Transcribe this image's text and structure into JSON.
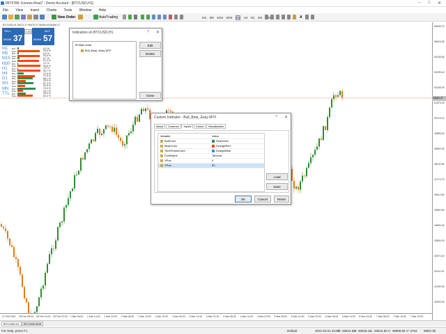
{
  "window": {
    "title": "8979786: Exness-Real7 - Demo Account - [BTCUSD,H1]"
  },
  "menu": [
    "File",
    "View",
    "Insert",
    "Charts",
    "Tools",
    "Window",
    "Help"
  ],
  "toolbar": {
    "new_order": "New Order",
    "auto_trading": "AutoTrading",
    "timeframes": [
      "M1",
      "M5",
      "M15",
      "M30",
      "H1",
      "H4",
      "D1",
      "W1",
      "MN"
    ]
  },
  "chart": {
    "symbol_label": "BTCUSD,H1  56471.47 56470.47 56450.45 56466.47",
    "current_price": "53653.47",
    "price_scale": [
      "55935.70",
      "55015.60",
      "54155.50",
      "53295.40",
      "52435.30",
      "51575.20",
      "50715.10",
      "49855.00",
      "48994.90",
      "48134.80",
      "47274.70",
      "46414.60",
      "45554.50",
      "44694.40",
      "43834.30",
      "42974.20",
      "42114.10",
      "41254.00",
      "40393.90"
    ],
    "time_scale": [
      "27 Feb 2021",
      "28 Feb 06:00",
      "28 Feb 14:00",
      "28 Feb 22:00",
      "1 Mar 06:00",
      "1 Mar 14:00",
      "1 Mar 22:00",
      "2 Mar 06:00",
      "2 Mar 14:00",
      "2 Mar 22:00",
      "3 Mar 06:00",
      "3 Mar 14:00",
      "3 Mar 22:00",
      "4 Mar 06:00",
      "4 Mar 14:00",
      "4 Mar 22:00",
      "5 Mar 06:00",
      "5 Mar 14:00",
      "5 Mar 22:00",
      "6 Mar 06:00",
      "6 Mar 14:00",
      "6 Mar 22:00",
      "7 Mar 06:00",
      "7 Mar 14:00",
      "7 Mar 22:00"
    ]
  },
  "oneclick": {
    "sell": "SELL",
    "buy": "BUY",
    "lot": "1.00",
    "sell_big": "37",
    "sell_small": "58458",
    "buy_big": "57",
    "buy_small": "58468"
  },
  "mtf": [
    {
      "tf": "M1",
      "bull": "Bull",
      "bear": "Bear",
      "bull_pct": "6.3 %",
      "bear_pct": "93.8 %",
      "bull_val": 6.3,
      "bear_val": 93.8
    },
    {
      "tf": "M5",
      "bull": "Bull",
      "bear": "Bear",
      "bull_pct": "6.0 %",
      "bear_pct": "94.0 %",
      "bull_val": 6.0,
      "bear_val": 94.0
    },
    {
      "tf": "M15",
      "bull": "Bull",
      "bear": "Bear",
      "bull_pct": "8.7 %",
      "bear_pct": "91.3 %",
      "bull_val": 8.7,
      "bear_val": 91.3
    },
    {
      "tf": "M30",
      "bull": "Bull",
      "bear": "Bear",
      "bull_pct": "4.2 %",
      "bear_pct": "95.8 %",
      "bull_val": 4.2,
      "bear_val": 95.8
    },
    {
      "tf": "H1",
      "bull": "Bull",
      "bear": "Bear",
      "bull_pct": "4.3 %",
      "bear_pct": "95.7 %",
      "bull_val": 4.3,
      "bear_val": 95.7
    },
    {
      "tf": "H4",
      "bull": "Bull",
      "bear": "Bear",
      "bull_pct": "27.5 %",
      "bear_pct": "72.5 %",
      "bull_val": 27.5,
      "bear_val": 72.5
    },
    {
      "tf": "D1",
      "bull": "Bull",
      "bear": "Bear",
      "bull_pct": "66.1 %",
      "bear_pct": "33.9 %",
      "bull_val": 66.1,
      "bear_val": 33.9
    },
    {
      "tf": "W1",
      "bull": "Bull",
      "bear": "Bear",
      "bull_pct": "67.4 %",
      "bear_pct": "32.6 %",
      "bull_val": 67.4,
      "bear_val": 32.6
    },
    {
      "tf": "MN",
      "bull": "Bull",
      "bear": "Bear",
      "bull_pct": "75.3 %",
      "bear_pct": "24.7 %",
      "bull_val": 75.3,
      "bear_val": 24.7
    },
    {
      "tf": "TTL",
      "bull": "Bull",
      "bear": "Bear",
      "bull_pct": "36.0 %",
      "bear_pct": "64.0 %",
      "bull_val": 36.0,
      "bear_val": 64.0
    }
  ],
  "indicators_dialog": {
    "title": "Indicators on BTCUSD,H1",
    "tree_root": "Main chart",
    "tree_item": "Bull_Bear_Easy MTF",
    "edit": "Edit",
    "delete": "Delete",
    "close": "Close"
  },
  "custom_dialog": {
    "title": "Custom Indicator - Bull_Bear_Easy MTF",
    "tabs": [
      "About",
      "Common",
      "Inputs",
      "Colors",
      "Visualization"
    ],
    "col_variable": "Variable",
    "col_value": "Value",
    "rows": [
      {
        "var": "BullColor",
        "val": "SeaGreen",
        "color": "#2e8b57"
      },
      {
        "var": "BearColor",
        "val": "OrangeRed",
        "color": "#ff4500"
      },
      {
        "var": "TimeFrameColor",
        "val": "DodgerBlue",
        "color": "#1e90ff"
      },
      {
        "var": "FontName",
        "val": "Tahoma",
        "color": ""
      },
      {
        "var": "XPos",
        "val": "0",
        "color": ""
      },
      {
        "var": "YPos",
        "val": "60",
        "color": ""
      }
    ],
    "load": "Load",
    "save": "Save",
    "ok": "OK",
    "cancel": "Cancel",
    "reset": "Reset"
  },
  "tabs": [
    "BTCUSD,H1",
    "BTCUSD,M15"
  ],
  "status": {
    "help": "For Help, press F1",
    "profile": "Default",
    "datetime": "2021.03.01 23:00",
    "open": "O: 48641.63",
    "high": "H: 49025.15",
    "low": "L: 48544.82",
    "close": "C: 48958.66",
    "volume": "V: 3763",
    "traffic": "598/1 kb"
  },
  "colors": {
    "bull": "#2e8b57",
    "bear": "#ff4500",
    "tf": "#1e90ff"
  }
}
